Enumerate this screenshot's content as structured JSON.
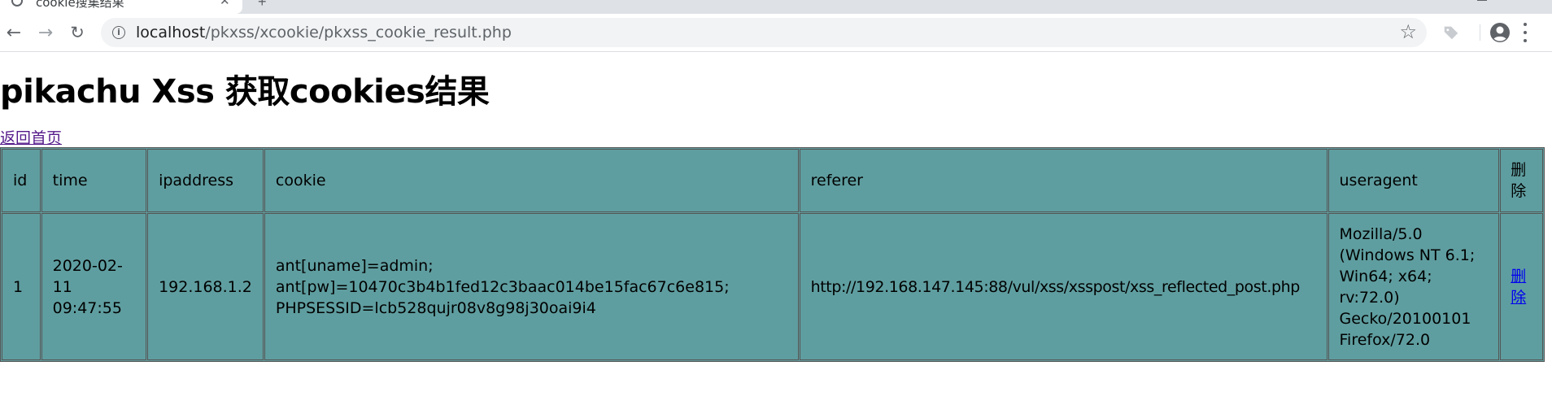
{
  "browser": {
    "tab_title": "cookie搜集结果",
    "url_host": "localhost",
    "url_path": "/pkxss/xcookie/pkxss_cookie_result.php"
  },
  "page": {
    "heading": "pikachu Xss 获取cookies结果",
    "home_link": "返回首页"
  },
  "table": {
    "headers": [
      "id",
      "time",
      "ipaddress",
      "cookie",
      "referer",
      "useragent",
      "删除"
    ],
    "rows": [
      {
        "id": "1",
        "time": "2020-02-11 09:47:55",
        "ipaddress": "192.168.1.2",
        "cookie": "ant[uname]=admin; ant[pw]=10470c3b4b1fed12c3baac014be15fac67c6e815; PHPSESSID=lcb528qujr08v8g98j30oai9i4",
        "referer": "http://192.168.147.145:88/vul/xss/xsspost/xss_reflected_post.php",
        "useragent": "Mozilla/5.0 (Windows NT 6.1; Win64; x64; rv:72.0) Gecko/20100101 Firefox/72.0",
        "delete_label": "删除"
      }
    ]
  },
  "colors": {
    "table_bg": "#5f9ea0",
    "visited_link": "#551a8b",
    "link": "#0000ee"
  }
}
